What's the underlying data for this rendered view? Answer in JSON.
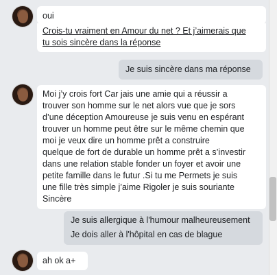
{
  "messages": [
    {
      "sender": "other",
      "lines": [
        "oui"
      ]
    },
    {
      "sender": "other",
      "lines": [
        "Crois-tu vraiment en Amour du net ? Et j’aimerais que",
        "tu sois sincère dans la réponse"
      ]
    },
    {
      "sender": "me",
      "lines": [
        "Je suis sincère dans ma réponse"
      ]
    },
    {
      "sender": "other",
      "lines": [
        "Moi j’y crois fort Car jais une amie qui a réussir a",
        "trouver son homme sur le net alors vue que je sors",
        "d’une déception Amoureuse je suis venu en espérant",
        "trouver un homme peut être sur le même chemin que",
        "moi je veux dire un homme prêt a construire",
        "quelque  de fort de durable un homme prêt a s’investir",
        "dans une relation stable fonder un foyer et avoir une",
        "petite famille dans le futur .Si tu me Permets je suis",
        "une fille très simple j’aime Rigoler je suis souriante",
        "Sincère"
      ]
    },
    {
      "sender": "me",
      "lines": [
        "Je suis allergique à l'humour malheureusement"
      ]
    },
    {
      "sender": "me",
      "lines": [
        "Je dois aller à l'hôpital en cas de blague"
      ]
    },
    {
      "sender": "other",
      "lines": [
        "ah  ok  a+"
      ]
    }
  ]
}
